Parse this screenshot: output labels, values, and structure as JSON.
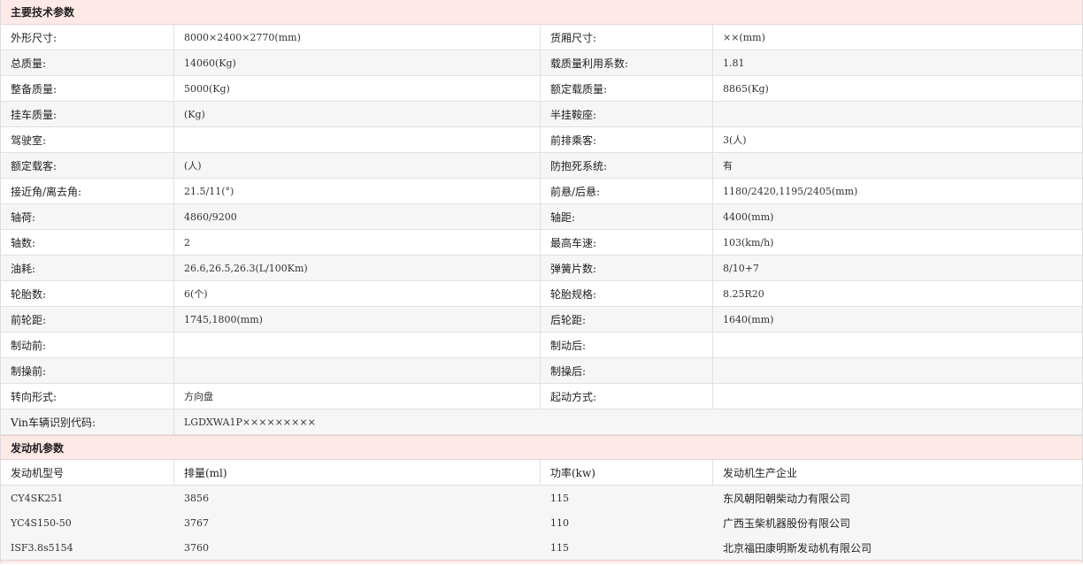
{
  "sections": {
    "main_title": "主要技术参数",
    "engine_title": "发动机参数"
  },
  "specs": [
    {
      "l1": "外形尺寸:",
      "v1": "8000×2400×2770(mm)",
      "l2": "货厢尺寸:",
      "v2": "××(mm)"
    },
    {
      "l1": "总质量:",
      "v1": "14060(Kg)",
      "l2": "载质量利用系数:",
      "v2": "1.81"
    },
    {
      "l1": "整备质量:",
      "v1": "5000(Kg)",
      "l2": "额定载质量:",
      "v2": "8865(Kg)"
    },
    {
      "l1": "挂车质量:",
      "v1": "(Kg)",
      "l2": "半挂鞍座:",
      "v2": ""
    },
    {
      "l1": "驾驶室:",
      "v1": "",
      "l2": "前排乘客:",
      "v2": "3(人)"
    },
    {
      "l1": "额定载客:",
      "v1": "(人)",
      "l2": "防抱死系统:",
      "v2": "有"
    },
    {
      "l1": "接近角/离去角:",
      "v1": "21.5/11(°)",
      "l2": "前悬/后悬:",
      "v2": "1180/2420,1195/2405(mm)"
    },
    {
      "l1": "轴荷:",
      "v1": "4860/9200",
      "l2": "轴距:",
      "v2": "4400(mm)"
    },
    {
      "l1": "轴数:",
      "v1": "2",
      "l2": "最高车速:",
      "v2": "103(km/h)"
    },
    {
      "l1": "油耗:",
      "v1": "26.6,26.5,26.3(L/100Km)",
      "l2": "弹簧片数:",
      "v2": "8/10+7"
    },
    {
      "l1": "轮胎数:",
      "v1": "6(个)",
      "l2": "轮胎规格:",
      "v2": "8.25R20"
    },
    {
      "l1": "前轮距:",
      "v1": "1745,1800(mm)",
      "l2": "后轮距:",
      "v2": "1640(mm)"
    },
    {
      "l1": "制动前:",
      "v1": "",
      "l2": "制动后:",
      "v2": ""
    },
    {
      "l1": "制操前:",
      "v1": "",
      "l2": "制操后:",
      "v2": ""
    },
    {
      "l1": "转向形式:",
      "v1": "方向盘",
      "l2": "起动方式:",
      "v2": ""
    }
  ],
  "vin": {
    "label": "Vin车辆识别代码:",
    "value": "LGDXWA1P×××××××××"
  },
  "engine_headers": [
    "发动机型号",
    "排量(ml)",
    "功率(kw)",
    "发动机生产企业"
  ],
  "engines": [
    [
      "CY4SK251",
      "3856",
      "115",
      "东风朝阳朝柴动力有限公司"
    ],
    [
      "YC4S150-50",
      "3767",
      "110",
      "广西玉柴机器股份有限公司"
    ],
    [
      "ISF3.8s5154",
      "3760",
      "115",
      "北京福田康明斯发动机有限公司"
    ]
  ]
}
